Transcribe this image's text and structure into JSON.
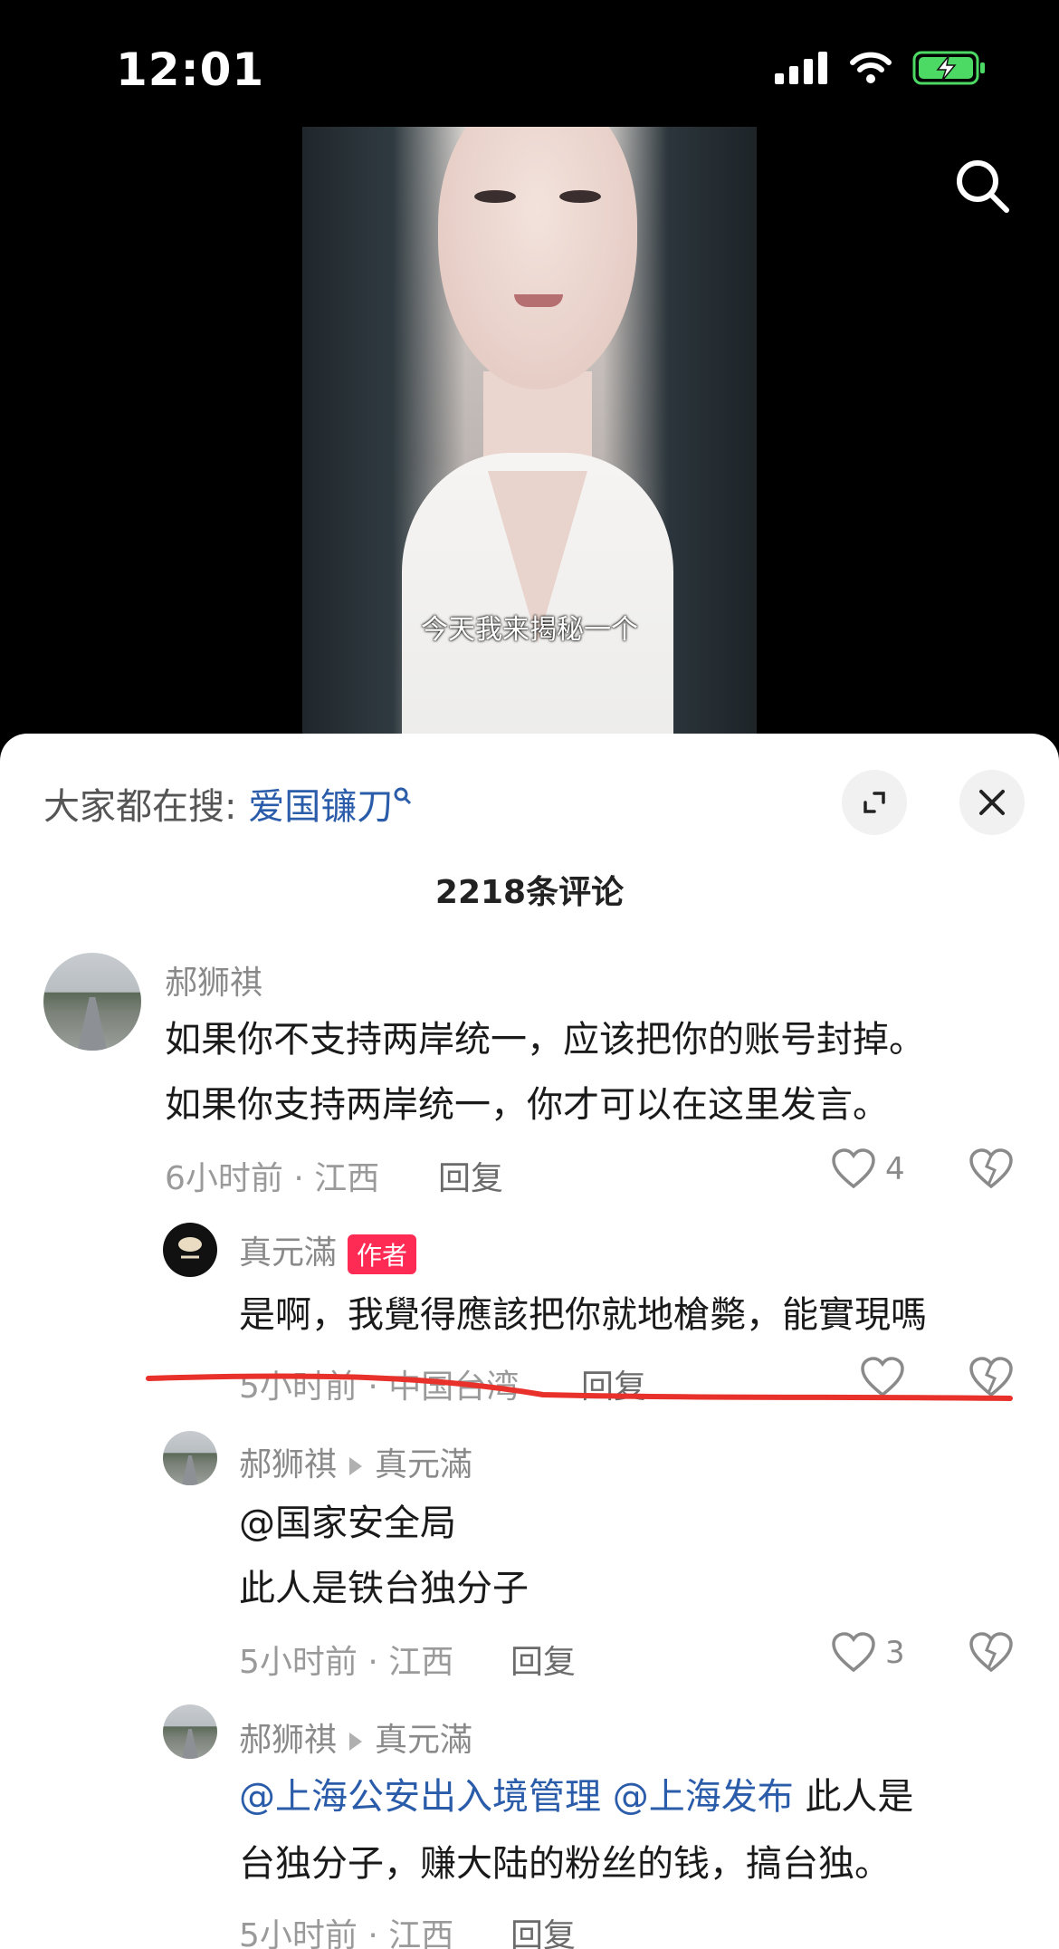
{
  "status": {
    "time": "12:01"
  },
  "video": {
    "subtitle": "今天我来揭秘一个"
  },
  "sheet": {
    "hot_prefix": "大家都在搜:",
    "hot_keyword": "爱国镰刀",
    "comment_count": "2218条评论"
  },
  "comments": [
    {
      "user": "郝狮祺",
      "text_1": "如果你不支持两岸统一，应该把你的账号封掉。",
      "text_2": "如果你支持两岸统一，你才可以在这里发言。",
      "meta": "6小时前 · 江西",
      "reply": "回复",
      "likes": "4"
    },
    {
      "user": "真元滿",
      "badge": "作者",
      "text": "是啊，我覺得應該把你就地槍斃，能實現嗎",
      "meta": "5小时前 · 中国台湾",
      "reply": "回复"
    },
    {
      "user": "郝狮祺",
      "reply_to": "真元滿",
      "text_1": "@国家安全局",
      "text_2": "此人是铁台独分子",
      "meta": "5小时前 · 江西",
      "reply": "回复",
      "likes": "3"
    },
    {
      "user": "郝狮祺",
      "reply_to": "真元滿",
      "mention_1": "@上海公安出入境管理",
      "mention_2": "@上海发布",
      "text_1_rest": "此人是",
      "text_2": "台独分子，赚大陆的粉丝的钱，搞台独。",
      "meta": "5小时前 · 江西",
      "reply": "回复"
    }
  ],
  "icons": {
    "search": "search-icon",
    "expand": "expand-icon",
    "close": "close-icon",
    "heart": "heart-icon",
    "broken_heart": "broken-heart-icon"
  },
  "colors": {
    "accent_red": "#fe2c55",
    "link_blue": "#2a5caa",
    "underline": "#e8312a"
  }
}
